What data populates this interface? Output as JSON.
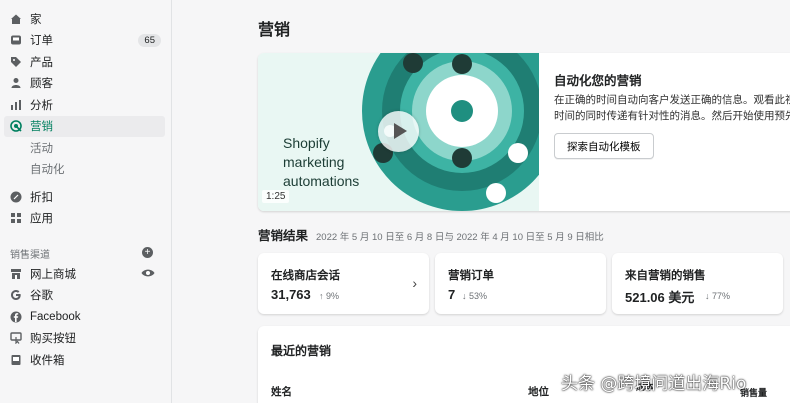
{
  "sidebar": {
    "items": [
      {
        "label": "家",
        "icon": "home-icon"
      },
      {
        "label": "订单",
        "icon": "orders-icon",
        "badge": "65"
      },
      {
        "label": "产品",
        "icon": "tag-icon"
      },
      {
        "label": "顾客",
        "icon": "person-icon"
      },
      {
        "label": "分析",
        "icon": "bar-chart-icon"
      },
      {
        "label": "营销",
        "icon": "target-icon",
        "active": true
      }
    ],
    "sub_items": [
      "活动",
      "自动化"
    ],
    "items2": [
      {
        "label": "折扣",
        "icon": "discount-icon"
      },
      {
        "label": "应用",
        "icon": "apps-icon"
      }
    ],
    "channels_title": "销售渠道",
    "channels": [
      {
        "label": "网上商城",
        "icon": "store-icon"
      },
      {
        "label": "谷歌",
        "icon": "google-icon"
      },
      {
        "label": "Facebook",
        "icon": "facebook-icon"
      },
      {
        "label": "购买按钮",
        "icon": "buy-button-icon"
      },
      {
        "label": "收件箱",
        "icon": "inbox-icon"
      }
    ]
  },
  "page": {
    "title": "营销"
  },
  "hero": {
    "image_line1": "Shopify",
    "image_line2": "marketing",
    "image_line3": "automations",
    "duration": "1:25",
    "title": "自动化您的营销",
    "desc_line1": "在正确的时间自动向客户发送正确的信息。观看此视",
    "desc_line2": "时间的同时传递有针对性的消息。然后开始使用预先",
    "button": "探索自动化模板"
  },
  "results": {
    "title": "营销结果",
    "range": "2022 年 5 月 10 日至 6 月 8 日与 2022 年 4 月 10 日至 5 月 9 日相比",
    "metrics": [
      {
        "label": "在线商店会话",
        "value": "31,763",
        "delta": "↑ 9%"
      },
      {
        "label": "营销订单",
        "value": "7",
        "delta": "↓ 53%"
      },
      {
        "label": "来自营销的销售",
        "value": "521.06 美元",
        "delta": "↓ 77%"
      }
    ]
  },
  "recent": {
    "title": "最近的营销",
    "columns": [
      "姓名",
      "地位",
      "成本",
      "销售量"
    ]
  },
  "watermark": "头条 @跨境问道出海Rio",
  "colors": {
    "accent": "#007f5f",
    "teal": "#2a9d8f",
    "dark": "#1f3b36"
  }
}
